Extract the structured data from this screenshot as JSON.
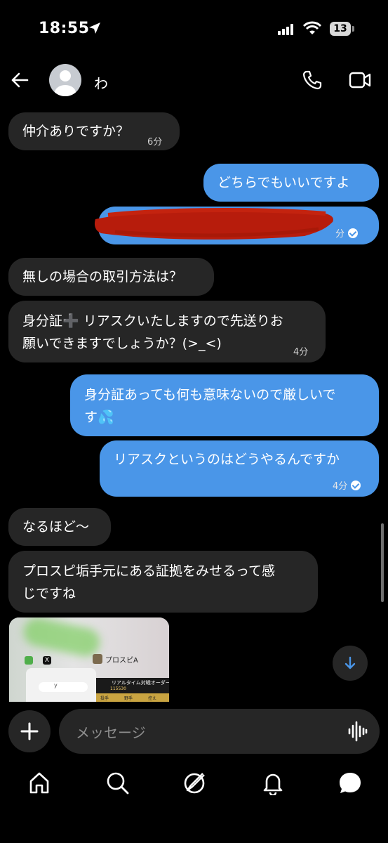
{
  "status_bar": {
    "time": "18:55",
    "battery": "13"
  },
  "header": {
    "contact_name": "わ"
  },
  "messages": [
    {
      "dir": "in",
      "text": "仲介ありですか？",
      "time": "6分"
    },
    {
      "dir": "out",
      "text": "どちらでもいいですよ"
    },
    {
      "dir": "out",
      "text": "",
      "time": "分",
      "redacted": true
    },
    {
      "dir": "in",
      "text": "無しの場合の取引方法は？"
    },
    {
      "dir": "in",
      "line1": "身分証➕ リアスクいたしますので先送りお",
      "line2": "願いできますでしょうか？(>_<)",
      "time": "4分"
    },
    {
      "dir": "out",
      "line1": "身分証あっても何も意味ないので厳しいで",
      "line2": "す💦"
    },
    {
      "dir": "out",
      "text": "リアスクというのはどうやるんですか",
      "time": "4分"
    },
    {
      "dir": "in",
      "text": "なるほど～"
    },
    {
      "dir": "in",
      "line1": "プロスピ垢手元にある証拠をみせるって感",
      "line2": "じですね"
    }
  ],
  "shared_image": {
    "tab_x": "X",
    "app_name": "プロスピA",
    "banner": "リアルタイム対戦オーダー",
    "score": "115530",
    "col1": "投手",
    "col2": "野手",
    "col3": "控え",
    "y_label": "y"
  },
  "composer": {
    "placeholder": "メッセージ"
  },
  "colors": {
    "outgoing": "#4a96e8",
    "incoming": "#262626",
    "background": "#000000",
    "redaction": "#b71c0c"
  },
  "icons": [
    "back-arrow-icon",
    "phone-icon",
    "video-camera-icon",
    "plus-icon",
    "microphone-waveform-icon",
    "home-icon",
    "search-icon",
    "compass-icon",
    "bell-icon",
    "chat-icon",
    "chevron-down-icon"
  ]
}
